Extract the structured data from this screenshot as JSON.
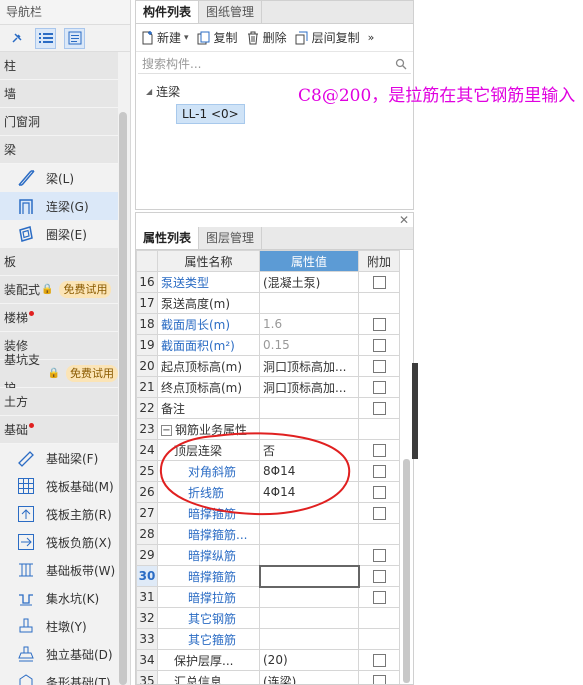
{
  "nav": {
    "title": "导航栏",
    "categories": {
      "zhu": "柱",
      "qiang": "墙",
      "menchuang": "门窗洞",
      "liang": "梁",
      "ban": "板",
      "zhuangpei": "装配式",
      "louti": "楼梯",
      "zhuangxiu": "装修",
      "jikeng": "基坑支护",
      "tufang": "土方",
      "jichu": "基础"
    },
    "badge_trial": "免费试用",
    "beam_items": [
      "梁(L)",
      "连梁(G)",
      "圈梁(E)"
    ],
    "foundation_items": [
      "基础梁(F)",
      "筏板基础(M)",
      "筏板主筋(R)",
      "筏板负筋(X)",
      "基础板带(W)",
      "集水坑(K)",
      "柱墩(Y)",
      "独立基础(D)",
      "条形基础(T)"
    ]
  },
  "component_panel": {
    "tabs": [
      "构件列表",
      "图纸管理"
    ],
    "toolbar": {
      "new": "新建",
      "copy": "复制",
      "delete": "删除",
      "floor_copy": "层间复制",
      "more": "»"
    },
    "search_placeholder": "搜索构件...",
    "tree_root": "连梁",
    "tree_leaf": "LL-1 <0>"
  },
  "property_panel": {
    "tabs": [
      "属性列表",
      "图层管理"
    ],
    "headers": {
      "name": "属性名称",
      "value": "属性值",
      "extra": "附加"
    },
    "rows": [
      {
        "n": "16",
        "name": "泵送类型",
        "value": "(混凝土泵)",
        "cb": true
      },
      {
        "n": "17",
        "name": "泵送高度(m)",
        "value": "",
        "cb": false
      },
      {
        "n": "18",
        "name": "截面周长(m)",
        "value": "1.6",
        "cb": true
      },
      {
        "n": "19",
        "name": "截面面积(m²)",
        "value": "0.15",
        "cb": true
      },
      {
        "n": "20",
        "name": "起点顶标高(m)",
        "value": "洞口顶标高加...",
        "cb": true
      },
      {
        "n": "21",
        "name": "终点顶标高(m)",
        "value": "洞口顶标高加...",
        "cb": true
      },
      {
        "n": "22",
        "name": "备注",
        "value": "",
        "cb": true
      },
      {
        "n": "23",
        "name": "钢筋业务属性",
        "value": "",
        "cb": false
      },
      {
        "n": "24",
        "name": "顶层连梁",
        "value": "否",
        "cb": true
      },
      {
        "n": "25",
        "name": "对角斜筋",
        "value": "8Φ14",
        "cb": true
      },
      {
        "n": "26",
        "name": "折线筋",
        "value": "4Φ14",
        "cb": true
      },
      {
        "n": "27",
        "name": "暗撑箍筋",
        "value": "",
        "cb": true
      },
      {
        "n": "28",
        "name": "暗撑箍筋...",
        "value": "",
        "cb": false
      },
      {
        "n": "29",
        "name": "暗撑纵筋",
        "value": "",
        "cb": true
      },
      {
        "n": "30",
        "name": "暗撑箍筋",
        "value": "",
        "cb": true
      },
      {
        "n": "31",
        "name": "暗撑拉筋",
        "value": "",
        "cb": true
      },
      {
        "n": "32",
        "name": "其它钢筋",
        "value": "",
        "cb": false
      },
      {
        "n": "33",
        "name": "其它箍筋",
        "value": "",
        "cb": false
      },
      {
        "n": "34",
        "name": "保护层厚...",
        "value": "(20)",
        "cb": true
      },
      {
        "n": "35",
        "name": "汇总信息",
        "value": "(连梁)",
        "cb": true
      }
    ]
  },
  "annotation": "C8@200，是拉筋在其它钢筋里输入",
  "colors": {
    "accent": "#2b6cc4",
    "header_highlight": "#5c9bd5",
    "annotation": "#e000e0",
    "ellipse": "#e02020"
  }
}
